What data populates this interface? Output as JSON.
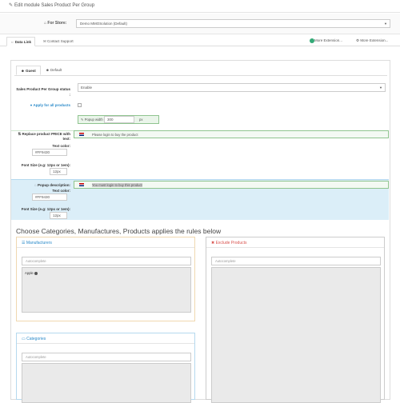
{
  "header": {
    "title": "Edit module Sales Product Per Group"
  },
  "store": {
    "label": "For Store:",
    "value": "Demo MMOSolution (Default)"
  },
  "tabs": [
    {
      "label": "Data Link"
    },
    {
      "label": "Contact Support"
    }
  ],
  "more_extensions": [
    "More Extension...",
    "More Extension..."
  ],
  "subtabs": [
    {
      "label": "Guest"
    },
    {
      "label": "Default"
    }
  ],
  "form": {
    "status_label": "Sales Product Per Group status :",
    "status_value": "Enable",
    "apply_all_label": "Apply for all products",
    "popup_width_label": "Popup width",
    "popup_width_value": "300",
    "popup_width_unit": "px",
    "replace_price_label": "Replace product PRICE with text:",
    "replace_price_placeholder": "Please login to buy the product",
    "text_color_label": "Text color:",
    "text_color_value": "#FF9430",
    "font_size_label": "Font Size (e.g: 12px or 1em):",
    "font_size_value": "12px",
    "popup_desc_label": "Popup description:",
    "popup_desc_value": "You must login to buy this product",
    "text_color2_label": "Text color:",
    "text_color2_value": "#FF9430",
    "font_size2_label": "Font Size (e.g: 12px or 1em):",
    "font_size2_value": "12px"
  },
  "rules_heading": "Choose Categories, Manufactures, Products applies the rules below",
  "manufacturers": {
    "title": "Manufacturers",
    "placeholder": "Autocomplete",
    "items": [
      "Apple"
    ]
  },
  "exclude": {
    "title": "Exclude Products",
    "placeholder": "Autocomplete"
  },
  "categories": {
    "title": "Categories",
    "placeholder": "Autocomplete"
  },
  "colors": {
    "blue": "#2a8ac9",
    "red": "#d9534f",
    "green_border": "#8fc48f",
    "blue_bg": "#dbeef8"
  }
}
